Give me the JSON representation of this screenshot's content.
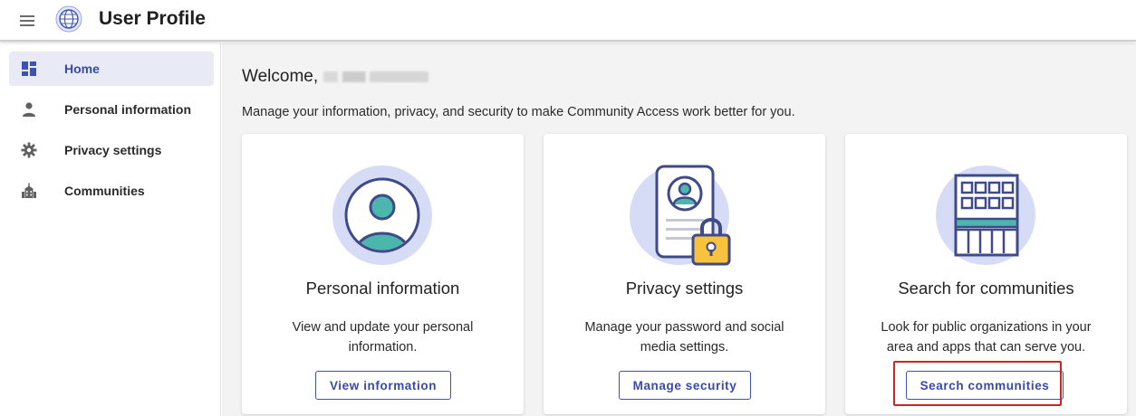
{
  "header": {
    "title": "User Profile",
    "menu_icon": "hamburger-menu-icon",
    "logo_icon": "globe-logo-icon"
  },
  "sidebar": {
    "items": [
      {
        "label": "Home",
        "icon": "dashboard-icon",
        "active": true
      },
      {
        "label": "Personal information",
        "icon": "person-icon",
        "active": false
      },
      {
        "label": "Privacy settings",
        "icon": "gear-icon",
        "active": false
      },
      {
        "label": "Communities",
        "icon": "building-icon",
        "active": false
      }
    ]
  },
  "main": {
    "welcome": "Welcome,",
    "subtitle": "Manage your information, privacy, and security to make Community Access work better for you.",
    "cards": [
      {
        "title": "Personal information",
        "description": "View and update your personal information.",
        "button": "View information",
        "icon": "person-avatar-icon"
      },
      {
        "title": "Privacy settings",
        "description": "Manage your password and social media settings.",
        "button": "Manage security",
        "icon": "id-card-lock-icon"
      },
      {
        "title": "Search for communities",
        "description": "Look for public organizations in your area and apps that can serve you.",
        "button": "Search communities",
        "icon": "building-windows-icon"
      }
    ]
  },
  "colors": {
    "accent": "#3f51b5",
    "active_nav_bg": "#e8eaf6",
    "illustration_circle": "#d6dcf5",
    "teal": "#4db6ac",
    "lock_yellow": "#f9c23c",
    "highlight_red": "#c62828"
  }
}
